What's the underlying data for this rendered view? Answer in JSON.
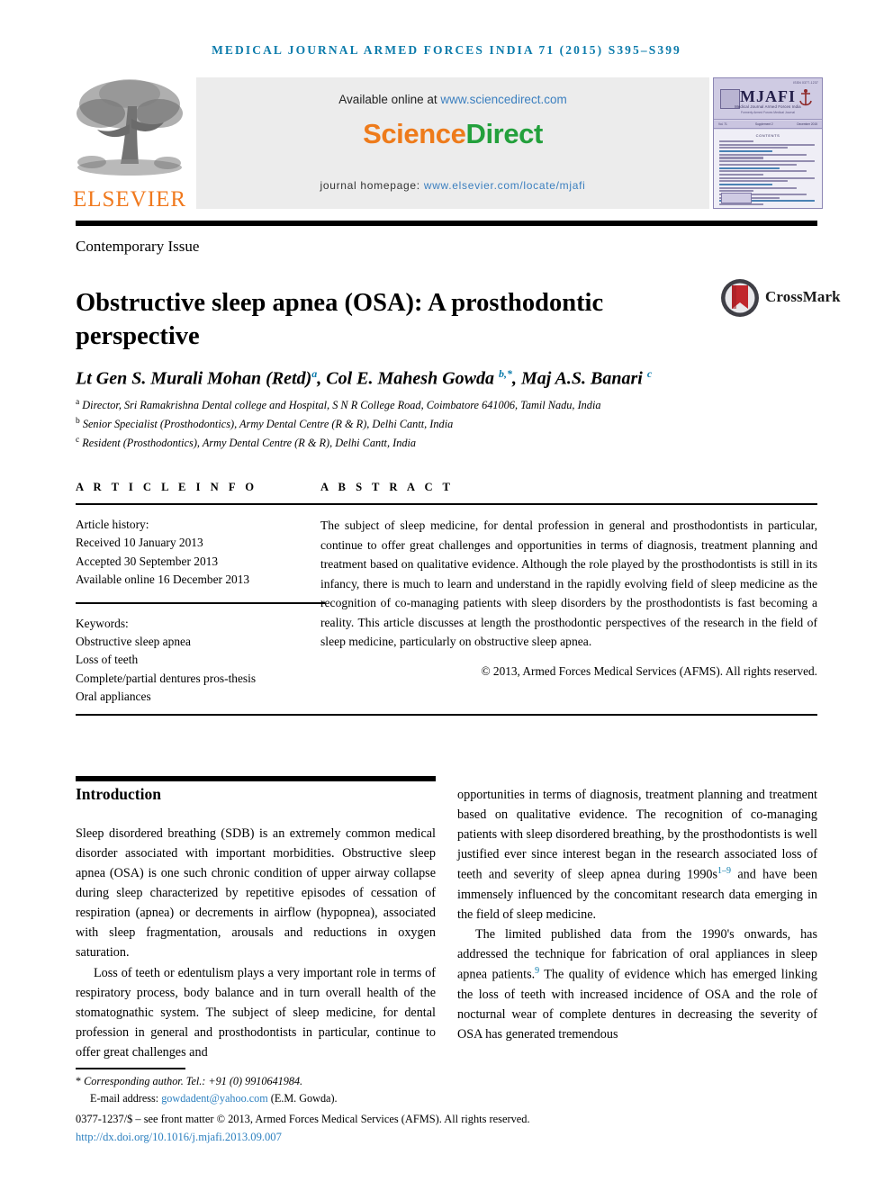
{
  "running_head": "MEDICAL JOURNAL ARMED FORCES INDIA 71 (2015) S395–S399",
  "masthead": {
    "elsevier_wordmark": "ELSEVIER",
    "available_label": "Available online at",
    "available_link": "www.sciencedirect.com",
    "sciencedirect_science": "Science",
    "sciencedirect_direct": "Direct",
    "homepage_label": "journal homepage:",
    "homepage_link": "www.elsevier.com/locate/mjafi"
  },
  "cover": {
    "issn": "ISSN 0377-1237",
    "title": "MJAFI",
    "subtitle": "Medical Journal Armed Forces India",
    "subtitle2": "Formerly Armed Forces Medical Journal",
    "volume": "Vol. 71",
    "issue": "Supplement 2",
    "date": "December 2015",
    "contents_title": "CONTENTS"
  },
  "article": {
    "type": "Contemporary Issue",
    "title": "Obstructive sleep apnea (OSA): A prosthodontic perspective",
    "crossmark_label": "CrossMark",
    "authors_html": "Lt Gen S. Murali Mohan (Retd)<sup>a</sup>, Col E. Mahesh Gowda <sup>b,*</sup>, Maj A.S. Banari <sup>c</sup>",
    "affiliations": [
      {
        "marker": "a",
        "text": "Director, Sri Ramakrishna Dental college and Hospital, S N R College Road, Coimbatore 641006, Tamil Nadu, India"
      },
      {
        "marker": "b",
        "text": "Senior Specialist (Prosthodontics), Army Dental Centre (R & R), Delhi Cantt, India"
      },
      {
        "marker": "c",
        "text": "Resident (Prosthodontics), Army Dental Centre (R & R), Delhi Cantt, India"
      }
    ]
  },
  "article_info": {
    "heading": "A R T I C L E   I N F O",
    "history_label": "Article history:",
    "received": "Received 10 January 2013",
    "accepted": "Accepted 30 September 2013",
    "available_online": "Available online 16 December 2013",
    "keywords_label": "Keywords:",
    "keywords": [
      "Obstructive sleep apnea",
      "Loss of teeth",
      "Complete/partial dentures pros-thesis",
      "Oral appliances"
    ]
  },
  "abstract": {
    "heading": "A B S T R A C T",
    "text": "The subject of sleep medicine, for dental profession in general and prosthodontists in particular, continue to offer great challenges and opportunities in terms of diagnosis, treatment planning and treatment based on qualitative evidence. Although the role played by the prosthodontists is still in its infancy, there is much to learn and understand in the rapidly evolving field of sleep medicine as the recognition of co-managing patients with sleep disorders by the prosthodontists is fast becoming a reality. This article discusses at length the prosthodontic perspectives of the research in the field of sleep medicine, particularly on obstructive sleep apnea.",
    "copyright": "© 2013, Armed Forces Medical Services (AFMS). All rights reserved."
  },
  "body": {
    "intro_heading": "Introduction",
    "left_paragraphs": [
      "Sleep disordered breathing (SDB) is an extremely common medical disorder associated with important morbidities. Obstructive sleep apnea (OSA) is one such chronic condition of upper airway collapse during sleep characterized by repetitive episodes of cessation of respiration (apnea) or decrements in airflow (hypopnea), associated with sleep fragmentation, arousals and reductions in oxygen saturation.",
      "Loss of teeth or edentulism plays a very important role in terms of respiratory process, body balance and in turn overall health of the stomatognathic system. The subject of sleep medicine, for dental profession in general and prosthodontists in particular, continue to offer great challenges and"
    ],
    "right_paragraph_1_pre": "opportunities in terms of diagnosis, treatment planning and treatment based on qualitative evidence. The recognition of co-managing patients with sleep disordered breathing, by the prosthodontists is well justified ever since interest began in the research associated loss of teeth and severity of sleep apnea during 1990s",
    "right_paragraph_1_ref": "1–9",
    "right_paragraph_1_post": " and have been immensely influenced by the concomitant research data emerging in the field of sleep medicine.",
    "right_paragraph_2_pre": "The limited published data from the 1990's onwards, has addressed the technique for fabrication of oral appliances in sleep apnea patients.",
    "right_paragraph_2_ref": "9",
    "right_paragraph_2_post": " The quality of evidence which has emerged linking the loss of teeth with increased incidence of OSA and the role of nocturnal wear of complete dentures in decreasing the severity of OSA has generated tremendous"
  },
  "footer": {
    "corresponding_star": "*",
    "corresponding_text": "Corresponding author. Tel.: +91 (0) 9910641984.",
    "email_label": "E-mail address:",
    "email": "gowdadent@yahoo.com",
    "email_owner": "(E.M. Gowda).",
    "front_matter": "0377-1237/$ – see front matter © 2013, Armed Forces Medical Services (AFMS). All rights reserved.",
    "doi": "http://dx.doi.org/10.1016/j.mjafi.2013.09.007"
  },
  "colors": {
    "running_head": "#0b7bab",
    "link": "#2b7fbf",
    "elsevier_orange": "#f0791e",
    "sciencedirect_green": "#23a03c",
    "sciencedirect_orange": "#ee7b1b",
    "crossmark_red": "#c1272d"
  }
}
